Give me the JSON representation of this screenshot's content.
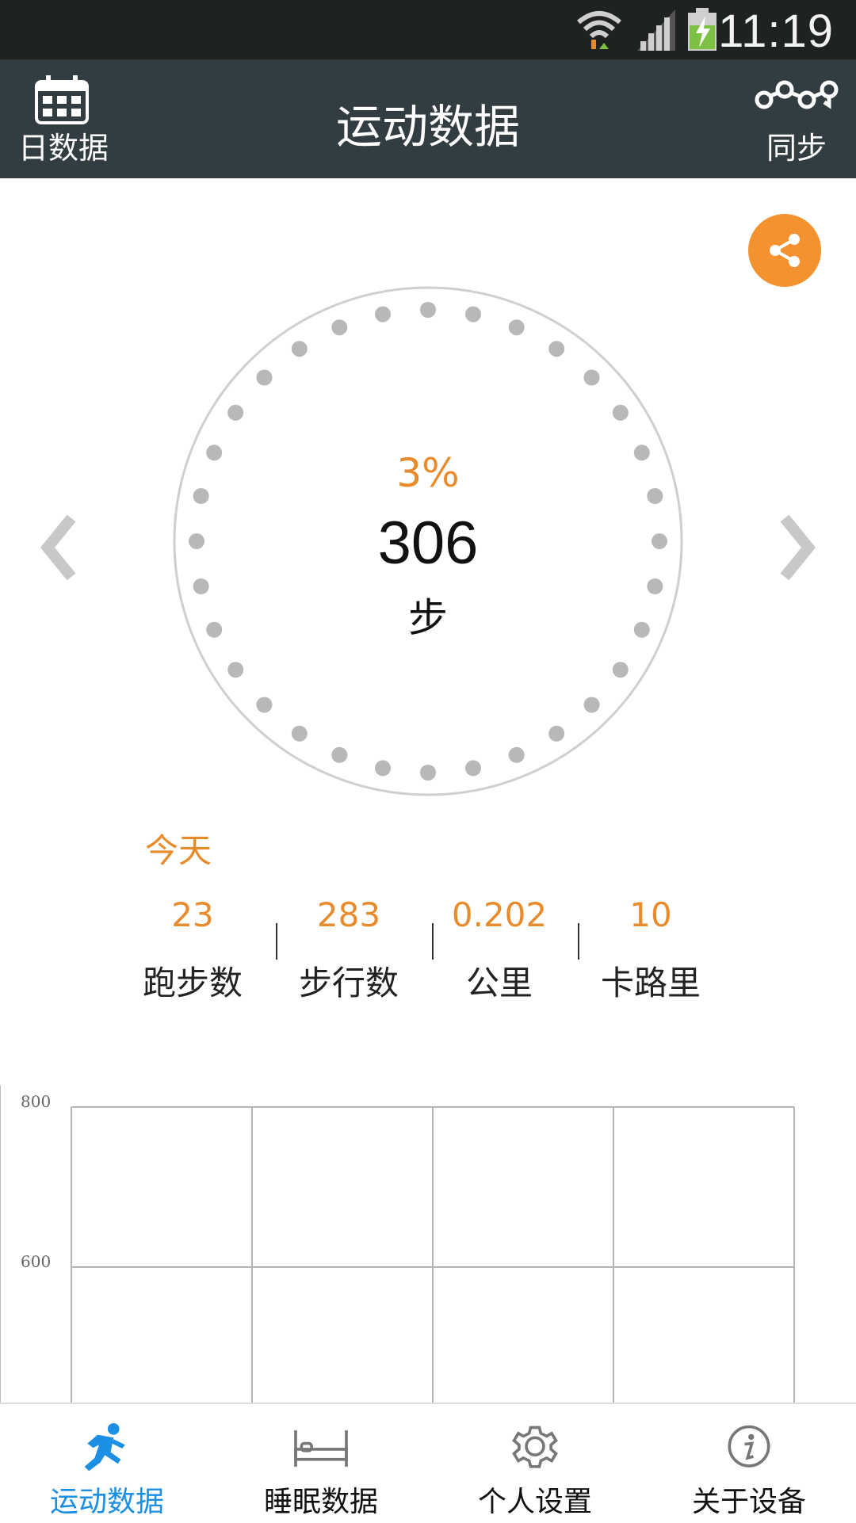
{
  "status_bar": {
    "time": "11:19"
  },
  "header": {
    "title": "运动数据",
    "left_button_label": "日数据",
    "right_button_label": "同步"
  },
  "progress": {
    "percent_text": "3%",
    "steps_value": "306",
    "steps_unit": "步",
    "fraction": 0.03
  },
  "summary": {
    "period_label": "今天",
    "stats": [
      {
        "value": "23",
        "label": "跑步数"
      },
      {
        "value": "283",
        "label": "步行数"
      },
      {
        "value": "0.202",
        "label": "公里"
      },
      {
        "value": "10",
        "label": "卡路里"
      }
    ]
  },
  "chart_data": {
    "type": "bar",
    "ytick_labels": [
      "800",
      "600"
    ],
    "values": [],
    "grid": true
  },
  "tabs": [
    {
      "label": "运动数据",
      "icon": "running-icon",
      "active": true
    },
    {
      "label": "睡眠数据",
      "icon": "bed-icon",
      "active": false
    },
    {
      "label": "个人设置",
      "icon": "gear-icon",
      "active": false
    },
    {
      "label": "关于设备",
      "icon": "info-icon",
      "active": false
    }
  ],
  "colors": {
    "accent_orange": "#e88b2c",
    "header_bg": "#323d42",
    "tab_active": "#1a8fe3"
  }
}
